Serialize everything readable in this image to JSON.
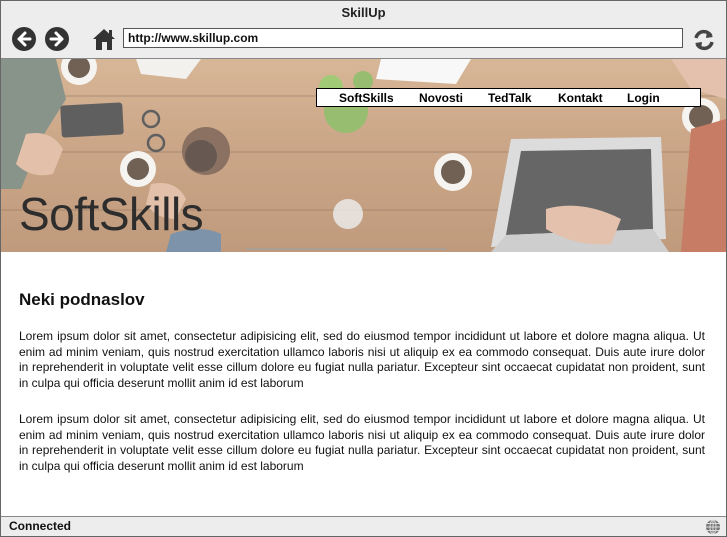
{
  "window": {
    "title": "SkillUp"
  },
  "toolbar": {
    "url": "http://www.skillup.com"
  },
  "hero": {
    "title": "SoftSkills"
  },
  "nav": {
    "items": [
      "SoftSkills",
      "Novosti",
      "TedTalk",
      "Kontakt",
      "Login"
    ]
  },
  "content": {
    "subheading": "Neki podnaslov",
    "paragraphs": [
      "Lorem ipsum dolor sit amet, consectetur adipisicing elit, sed do eiusmod tempor incididunt ut labore et dolore magna aliqua. Ut enim ad minim veniam, quis nostrud exercitation ullamco laboris nisi ut aliquip ex ea commodo consequat. Duis aute irure dolor in reprehenderit in voluptate velit esse cillum dolore eu fugiat nulla pariatur. Excepteur sint occaecat cupidatat non proident, sunt in culpa qui officia deserunt mollit anim id est laborum",
      "Lorem ipsum dolor sit amet, consectetur adipisicing elit, sed do eiusmod tempor incididunt ut labore et dolore magna aliqua. Ut enim ad minim veniam, quis nostrud exercitation ullamco laboris nisi ut aliquip ex ea commodo consequat. Duis aute irure dolor in reprehenderit in voluptate velit esse cillum dolore eu fugiat nulla pariatur. Excepteur sint occaecat cupidatat non proident, sunt in culpa qui officia deserunt mollit anim id est laborum"
    ]
  },
  "status": {
    "text": "Connected"
  },
  "icons": {
    "back": "arrow-left-icon",
    "forward": "arrow-right-icon",
    "home": "home-icon",
    "reload": "reload-icon",
    "status": "globe-icon"
  }
}
